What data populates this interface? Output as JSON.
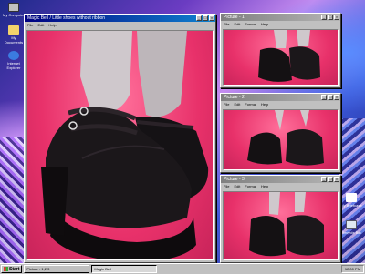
{
  "desktop_icons": [
    {
      "name": "my-computer",
      "label": "My Computer",
      "icon": "computer-icon"
    },
    {
      "name": "my-documents",
      "label": "My Documents",
      "icon": "folder-icon"
    },
    {
      "name": "internet-explorer",
      "label": "Internet Explorer",
      "icon": "ie-icon"
    },
    {
      "name": "my-briefcase",
      "label": "My Briefcase",
      "icon": "briefcase-icon"
    },
    {
      "name": "recycle-bin",
      "label": "Recycle Bin",
      "icon": "recycle-bin-icon"
    }
  ],
  "main_window": {
    "title": "Magic Bell / Little shoes without ribbon",
    "menu": [
      "File",
      "Edit",
      "Help"
    ]
  },
  "picture_windows": [
    {
      "title": "Picture - 1",
      "menu": [
        "File",
        "Edit",
        "Format",
        "Help"
      ]
    },
    {
      "title": "Picture - 2",
      "menu": [
        "File",
        "Edit",
        "Format",
        "Help"
      ]
    },
    {
      "title": "Picture - 3",
      "menu": [
        "File",
        "Edit",
        "Format",
        "Help"
      ]
    }
  ],
  "taskbar": {
    "start_label": "Start",
    "items": [
      "Picture - 1,2,3",
      "Magic Bell"
    ],
    "clock": "12:00 PM"
  },
  "colors": {
    "pink_bg": "#e8316a",
    "titlebar_active": "#000080",
    "window_gray": "#c0c0c0"
  }
}
